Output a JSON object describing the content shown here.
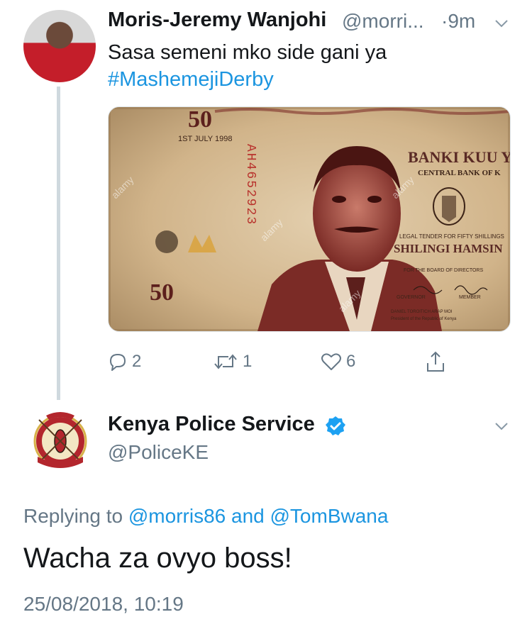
{
  "tweet1": {
    "display_name": "Moris-Jeremy Wanjohi",
    "handle": "@morri...",
    "time": "·9m",
    "text_line1": "Sasa semeni mko side gani ya",
    "hashtag": "#MashemejiDerby",
    "media": {
      "note_denomination": "50",
      "date_text": "1ST JULY 1998",
      "serial": "AH4652923",
      "bank_title": "BANKI KUU YA",
      "bank_subtitle": "CENTRAL BANK OF K",
      "legal_tender": "LEGAL TENDER FOR FIFTY SHILLINGS",
      "shilingi": "SHILINGI HAMSIN",
      "board": "FOR THE BOARD OF DIRECTORS",
      "governor": "GOVERNOR",
      "member": "MEMBER",
      "president": "DANIEL TOROITICH ARAP MOI",
      "president_title": "President of the Republic of Kenya",
      "watermark": "alamy"
    },
    "actions": {
      "reply_count": "2",
      "retweet_count": "1",
      "like_count": "6"
    }
  },
  "tweet2": {
    "display_name": "Kenya Police Service",
    "handle": "@PoliceKE",
    "replying_prefix": "Replying to",
    "reply_user1": "@morris86",
    "reply_and": "and",
    "reply_user2": "@TomBwana",
    "text": "Wacha za ovyo boss!",
    "timestamp": "25/08/2018, 10:19"
  },
  "colors": {
    "link": "#1b95e0",
    "muted": "#657786",
    "text": "#14171a",
    "thread_line": "#cfd9de"
  }
}
